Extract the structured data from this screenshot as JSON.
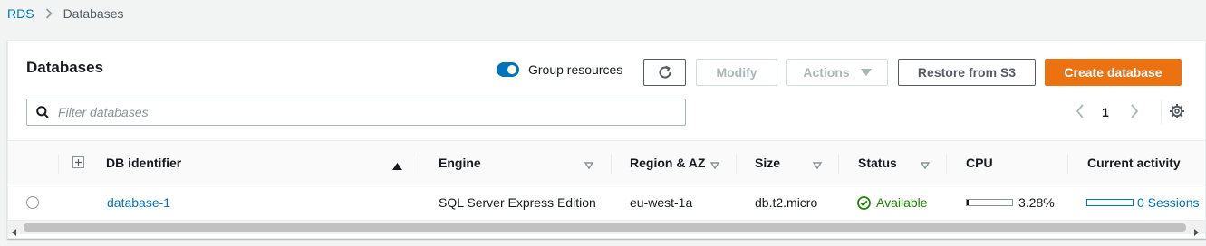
{
  "breadcrumb": {
    "root": "RDS",
    "current": "Databases"
  },
  "panel": {
    "title": "Databases"
  },
  "toolbar": {
    "group_resources_label": "Group resources",
    "group_resources_on": true,
    "modify_label": "Modify",
    "actions_label": "Actions",
    "restore_label": "Restore from S3",
    "create_label": "Create database"
  },
  "search": {
    "placeholder": "Filter databases",
    "value": ""
  },
  "pagination": {
    "current_page": "1"
  },
  "table": {
    "columns": [
      "DB identifier",
      "Engine",
      "Region & AZ",
      "Size",
      "Status",
      "CPU",
      "Current activity"
    ],
    "rows": [
      {
        "db_identifier": "database-1",
        "engine": "SQL Server Express Edition",
        "region_az": "eu-west-1a",
        "size": "db.t2.micro",
        "status": "Available",
        "cpu": "3.28%",
        "cpu_fraction": 0.0328,
        "activity": "0 Sessions"
      }
    ]
  },
  "colors": {
    "accent": "#0073bb",
    "primary_button": "#ec7211",
    "status_ok": "#1d8102"
  }
}
